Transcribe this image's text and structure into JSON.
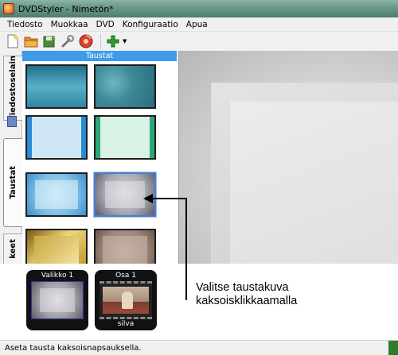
{
  "window": {
    "title": "DVDStyler - Nimetön*"
  },
  "menu": [
    "Tiedosto",
    "Muokkaa",
    "DVD",
    "Konfiguraatio",
    "Apua"
  ],
  "toolbar": {
    "buttons": [
      "new-file-icon",
      "open-folder-icon",
      "save-icon",
      "settings-icon",
      "burn-disc-icon",
      "add-icon"
    ],
    "colors": {
      "add": "#2e9b2e",
      "burn": "#d8402a",
      "folder": "#e8902a"
    }
  },
  "tabs": {
    "file_browser": "Tiedostoselain",
    "backgrounds": "Taustat",
    "buttons": "keet"
  },
  "panel": {
    "header": "Taustat",
    "header_color": "#3d9be9"
  },
  "titleset": {
    "menu_label": "Valikko 1",
    "title_label": "Osa 1",
    "title_sub": "silva"
  },
  "annotation": {
    "line1": "Valitse taustakuva",
    "line2": "kaksoisklikkaamalla"
  },
  "status": {
    "text": "Aseta tausta kaksoisnapsauksella."
  }
}
